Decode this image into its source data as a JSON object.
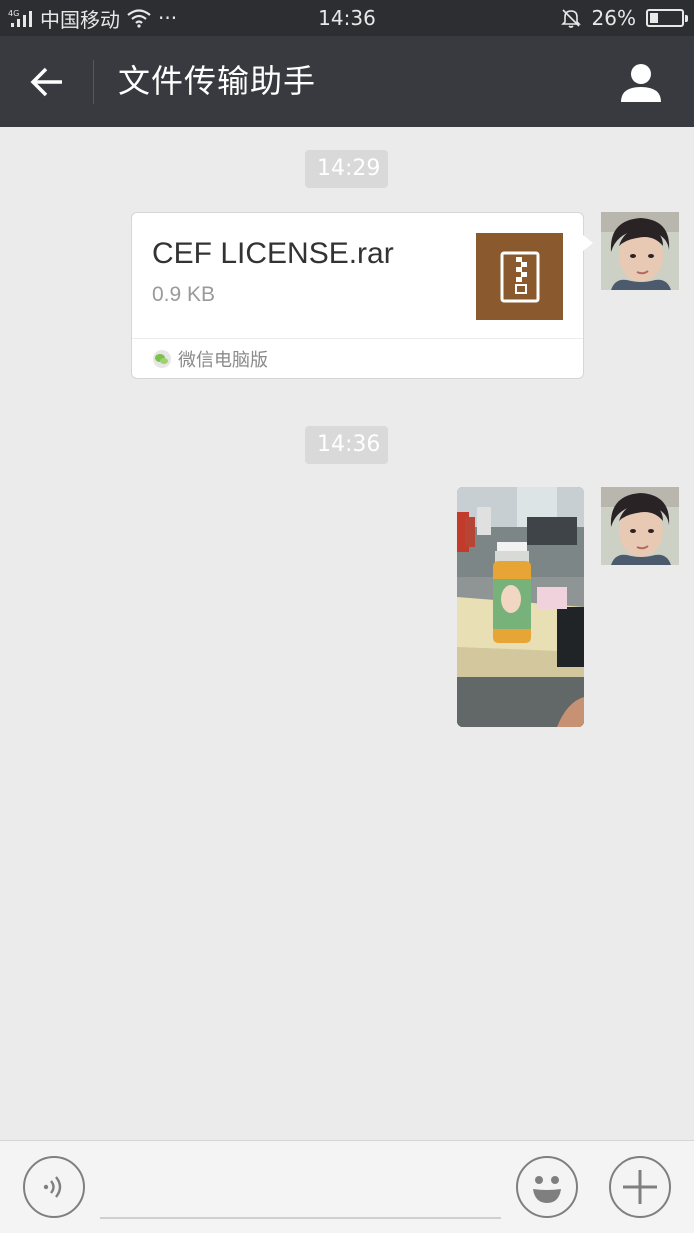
{
  "status_bar": {
    "network": "4G",
    "carrier": "中国移动",
    "more": "···",
    "time": "14:36",
    "battery_text": "26%",
    "battery_level": 0.26
  },
  "header": {
    "title": "文件传输助手"
  },
  "messages": [
    {
      "timestamp": "14:29",
      "type": "file",
      "file_name": "CEF LICENSE.rar",
      "file_size": "0.9 KB",
      "source": "微信电脑版"
    },
    {
      "timestamp": "14:36",
      "type": "image"
    }
  ],
  "icons": {
    "back": "arrow-left-icon",
    "profile": "person-icon",
    "file": "zip-archive-icon",
    "source": "wechat-logo-icon",
    "voice": "voice-icon",
    "emoji": "smiley-icon",
    "more": "plus-icon"
  },
  "colors": {
    "status_bar_bg": "#2d2e31",
    "title_bar_bg": "#393a3f",
    "chat_bg": "#ebebeb",
    "file_icon_bg": "#8a5a2e",
    "timestamp_bg": "#d9d9d9"
  }
}
